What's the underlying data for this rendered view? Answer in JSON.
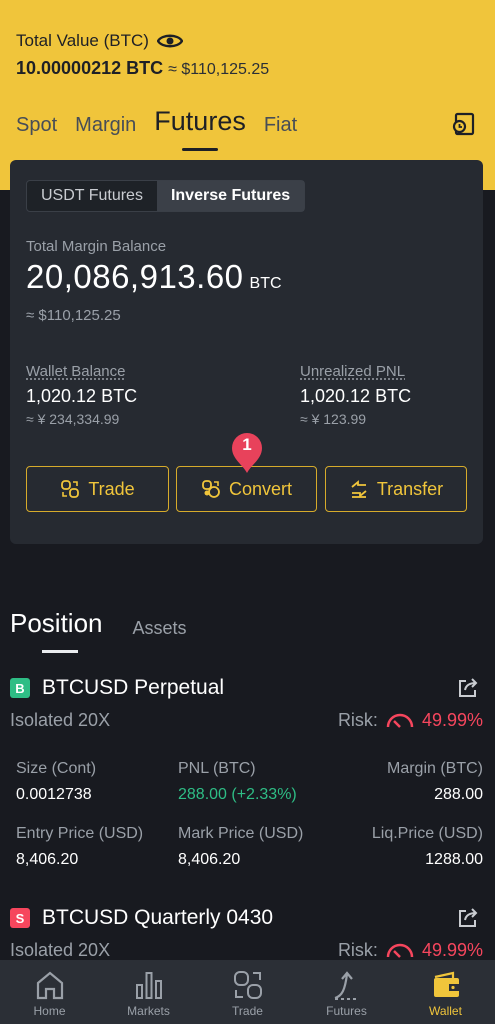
{
  "header": {
    "total_value_label": "Total Value (BTC)",
    "total_value_btc": "10.00000212 BTC",
    "total_value_fiat": "≈ $110,125.25",
    "tabs": [
      "Spot",
      "Margin",
      "Futures",
      "Fiat"
    ],
    "active_tab": "Futures"
  },
  "card": {
    "segments": [
      "USDT Futures",
      "Inverse Futures"
    ],
    "active_segment": "Inverse Futures",
    "total_margin_label": "Total Margin Balance",
    "total_margin_value": "20,086,913.60",
    "total_margin_unit": "BTC",
    "total_margin_fiat": "≈ $110,125.25",
    "wallet_label": "Wallet Balance",
    "wallet_value": "1,020.12 BTC",
    "wallet_fiat": "≈ ¥ 234,334.99",
    "upnl_label": "Unrealized PNL",
    "upnl_value": "1,020.12 BTC",
    "upnl_fiat": "≈ ¥ 123.99",
    "buttons": {
      "trade": "Trade",
      "convert": "Convert",
      "transfer": "Transfer"
    },
    "pin_number": "1"
  },
  "positions": {
    "tabs": [
      "Position",
      "Assets"
    ],
    "items": [
      {
        "badge": "B",
        "badge_color": "#2ebd85",
        "symbol": "BTCUSD Perpetual",
        "mode": "Isolated 20X",
        "risk_label": "Risk:",
        "risk_value": "49.99%",
        "size_label": "Size (Cont)",
        "size_value": "0.0012738",
        "pnl_label": "PNL (BTC)",
        "pnl_value": "288.00 (+2.33%)",
        "margin_label": "Margin (BTC)",
        "margin_value": "288.00",
        "entry_label": "Entry Price (USD)",
        "entry_value": "8,406.20",
        "mark_label": "Mark Price (USD)",
        "mark_value": "8,406.20",
        "liq_label": "Liq.Price (USD)",
        "liq_value": "1288.00"
      },
      {
        "badge": "S",
        "badge_color": "#f6465d",
        "symbol": "BTCUSD Quarterly 0430",
        "mode": "Isolated 20X",
        "risk_label": "Risk:",
        "risk_value": "49.99%"
      }
    ]
  },
  "nav": {
    "items": [
      "Home",
      "Markets",
      "Trade",
      "Futures",
      "Wallet"
    ],
    "active": "Wallet"
  },
  "colors": {
    "accent": "#f0c53b",
    "green": "#2ebd85",
    "red": "#f6465d"
  }
}
